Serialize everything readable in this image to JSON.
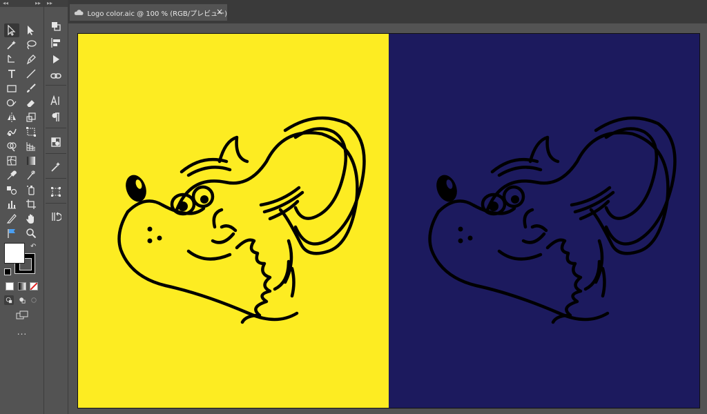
{
  "tab": {
    "cloud_icon": "cloud-icon",
    "title": "Logo color.aic @ 100 % (RGB/プレビュー)",
    "close": "×"
  },
  "toolbar": {
    "collapse_left": "◂◂",
    "collapse_right": "▸▸",
    "more_label": "..."
  },
  "artboard": {
    "left_color": "#FDEC22",
    "right_color": "#1C1A5E",
    "line_color": "#000000"
  },
  "colors": {
    "fill": "#FFFFFF",
    "stroke": "#000000"
  }
}
